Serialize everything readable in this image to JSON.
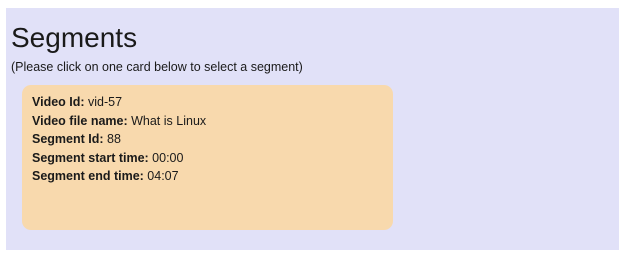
{
  "page": {
    "title": "Segments",
    "subtitle": "(Please click on one card below to select a segment)"
  },
  "segments": [
    {
      "fields": [
        {
          "label": "Video Id:",
          "value": "vid-57"
        },
        {
          "label": "Video file name:",
          "value": "What is Linux"
        },
        {
          "label": "Segment Id:",
          "value": "88"
        },
        {
          "label": "Segment start time:",
          "value": "00:00"
        },
        {
          "label": "Segment end time:",
          "value": "04:07"
        }
      ]
    }
  ],
  "colors": {
    "panel_background": "#e1e1f8",
    "card_background": "#f8d9ad"
  }
}
